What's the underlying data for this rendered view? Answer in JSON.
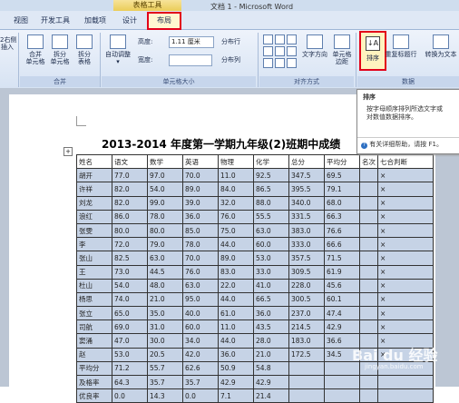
{
  "window": {
    "title": "文档 1 - Microsoft Word",
    "context_tab": "表格工具"
  },
  "tabs": [
    "视图",
    "开发工具",
    "加载项",
    "设计",
    "布局"
  ],
  "ribbon": {
    "left_cut": "2右侧\n插入",
    "merge": [
      "合并\n单元格",
      "拆分\n单元格",
      "拆分\n表格"
    ],
    "autofit": "自动调整",
    "height_label": "高度:",
    "height_value": "1.11 厘米",
    "width_label": "宽度:",
    "dist_row": "分布行",
    "dist_col": "分布列",
    "text_dir": "文字方向",
    "cell_margin": "单元格\n边距",
    "sort": "排序",
    "repeat_header": "重复标题行",
    "convert": "转换为文本",
    "groups": [
      "合并",
      "单元格大小",
      "对齐方式",
      "数据"
    ]
  },
  "tooltip": {
    "title": "排序",
    "body": "按字母顺序排列所选文字或\n对数值数据排序。",
    "help": "有关详细帮助，请按 F1。"
  },
  "document": {
    "title": "2013-2014 年度第一学期九年级(2)班期中成绩",
    "headers": [
      "姓名",
      "语文",
      "数学",
      "英语",
      "物理",
      "化学",
      "总分",
      "平均分",
      "名次",
      "七合判断"
    ],
    "rows": [
      [
        "胡开",
        "77.0",
        "97.0",
        "70.0",
        "11.0",
        "92.5",
        "347.5",
        "69.5",
        "",
        "×"
      ],
      [
        "许祥",
        "82.0",
        "54.0",
        "89.0",
        "84.0",
        "86.5",
        "395.5",
        "79.1",
        "",
        "×"
      ],
      [
        "刘龙",
        "82.0",
        "99.0",
        "39.0",
        "32.0",
        "88.0",
        "340.0",
        "68.0",
        "",
        "×"
      ],
      [
        "浪红",
        "86.0",
        "78.0",
        "36.0",
        "76.0",
        "55.5",
        "331.5",
        "66.3",
        "",
        "×"
      ],
      [
        "张雯",
        "80.0",
        "80.0",
        "85.0",
        "75.0",
        "63.0",
        "383.0",
        "76.6",
        "",
        "×"
      ],
      [
        "李",
        "72.0",
        "79.0",
        "78.0",
        "44.0",
        "60.0",
        "333.0",
        "66.6",
        "",
        "×"
      ],
      [
        "张山",
        "82.5",
        "63.0",
        "70.0",
        "89.0",
        "53.0",
        "357.5",
        "71.5",
        "",
        "×"
      ],
      [
        "王",
        "73.0",
        "44.5",
        "76.0",
        "83.0",
        "33.0",
        "309.5",
        "61.9",
        "",
        "×"
      ],
      [
        "杜山",
        "54.0",
        "48.0",
        "63.0",
        "22.0",
        "41.0",
        "228.0",
        "45.6",
        "",
        "×"
      ],
      [
        "杨思",
        "74.0",
        "21.0",
        "95.0",
        "44.0",
        "66.5",
        "300.5",
        "60.1",
        "",
        "×"
      ],
      [
        "张立",
        "65.0",
        "35.0",
        "40.0",
        "61.0",
        "36.0",
        "237.0",
        "47.4",
        "",
        "×"
      ],
      [
        "司航",
        "69.0",
        "31.0",
        "60.0",
        "11.0",
        "43.5",
        "214.5",
        "42.9",
        "",
        "×"
      ],
      [
        "窦涌",
        "47.0",
        "30.0",
        "34.0",
        "44.0",
        "28.0",
        "183.0",
        "36.6",
        "",
        "×"
      ],
      [
        "赵",
        "53.0",
        "20.5",
        "42.0",
        "36.0",
        "21.0",
        "172.5",
        "34.5",
        "",
        "×"
      ],
      [
        "平均分",
        "71.2",
        "55.7",
        "62.6",
        "50.9",
        "54.8",
        "",
        "",
        "",
        ""
      ],
      [
        "及格率",
        "64.3",
        "35.7",
        "35.7",
        "42.9",
        "42.9",
        "",
        "",
        "",
        ""
      ],
      [
        "优良率",
        "0.0",
        "14.3",
        "0.0",
        "7.1",
        "21.4",
        "",
        "",
        "",
        ""
      ]
    ]
  },
  "watermark": {
    "text": "Bai du 经验",
    "sub": "jingyan.baidu.com"
  },
  "colors": {
    "highlight": "#e2001a",
    "ribbon": "#dfe8f5",
    "table_fill": "#c6d3e6"
  }
}
